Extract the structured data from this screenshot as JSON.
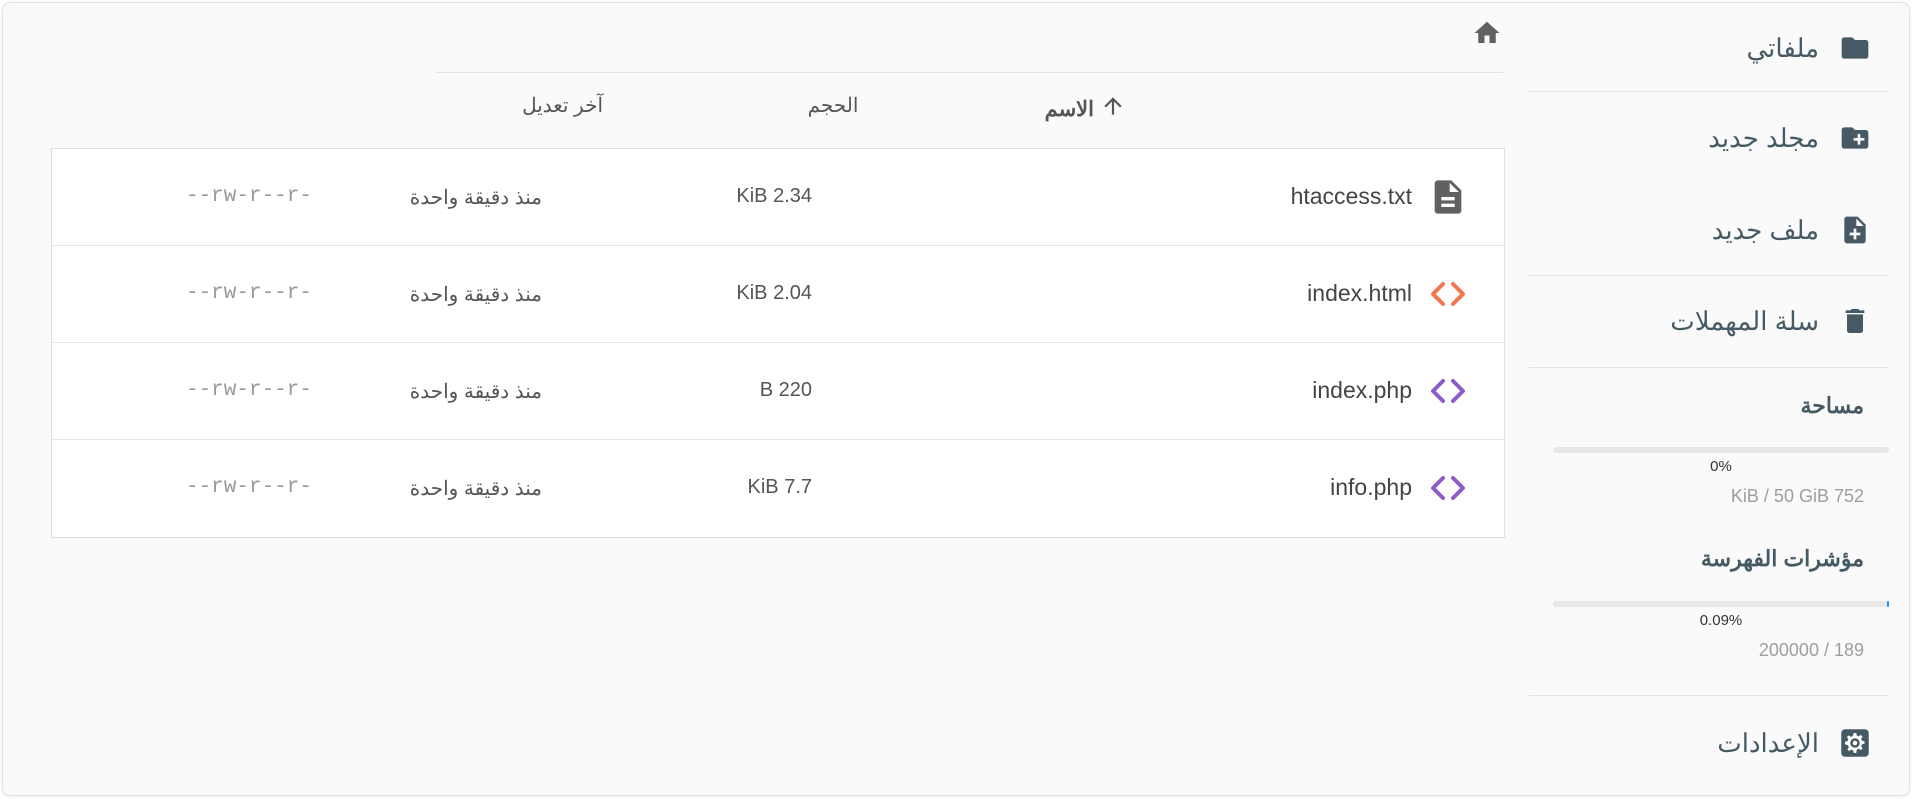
{
  "sidebar": {
    "my_files": "ملفاتي",
    "new_folder": "مجلد جديد",
    "new_file": "ملف جديد",
    "trash": "سلة المهملات",
    "settings": "الإعدادات",
    "space": {
      "title": "مساحة",
      "percent_label": "0%",
      "percent": 0,
      "detail": "KiB / 50 GiB 752"
    },
    "inodes": {
      "title": "مؤشرات الفهرسة",
      "percent_label": "0.09%",
      "percent": 0.09,
      "detail": "200000 / 189"
    }
  },
  "columns": {
    "name": "الاسم",
    "size": "الحجم",
    "modified": "آخر تعديل"
  },
  "files": [
    {
      "name": "htaccess.txt",
      "size": "KiB 2.34",
      "modified": "منذ دقيقة واحدة",
      "permissions": "--rw-r--r-",
      "icon": "text-file-icon",
      "icon_color": "#616161"
    },
    {
      "name": "index.html",
      "size": "KiB 2.04",
      "modified": "منذ دقيقة واحدة",
      "permissions": "--rw-r--r-",
      "icon": "code-icon",
      "icon_color": "#f4764c"
    },
    {
      "name": "index.php",
      "size": "B 220",
      "modified": "منذ دقيقة واحدة",
      "permissions": "--rw-r--r-",
      "icon": "code-icon",
      "icon_color": "#8e5cc9"
    },
    {
      "name": "info.php",
      "size": "KiB 7.7",
      "modified": "منذ دقيقة واحدة",
      "permissions": "--rw-r--r-",
      "icon": "code-icon",
      "icon_color": "#8e5cc9"
    }
  ],
  "colors": {
    "sidebar_text": "#455a64",
    "accent": "#2196f3"
  }
}
